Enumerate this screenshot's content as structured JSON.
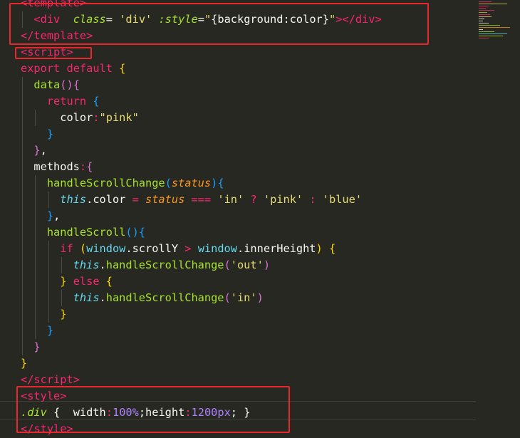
{
  "theme": {
    "background": "#272822",
    "default": "#f8f8f2",
    "tag": "#f92672",
    "attribute": "#a6e22e",
    "string": "#e6db74",
    "keyword": "#f92672",
    "function": "#a6e22e",
    "parameter": "#fd971f",
    "builtin": "#66d9ef",
    "number": "#ae81ff",
    "bracket_gold": "#ffd700",
    "bracket_purple": "#da70d6",
    "bracket_blue": "#179fff",
    "annotation": "#e8282c"
  },
  "code": {
    "lines": [
      [
        [
          "<",
          "tag"
        ],
        [
          "template",
          "tag"
        ],
        [
          ">",
          "tag"
        ]
      ],
      [
        [
          "  ",
          "default"
        ],
        [
          "<",
          "tag"
        ],
        [
          "div",
          "tag"
        ],
        [
          "  ",
          "default"
        ],
        [
          "class",
          "attribute",
          "italic"
        ],
        [
          "= ",
          "default"
        ],
        [
          "'div'",
          "string"
        ],
        [
          " ",
          "default"
        ],
        [
          ":style",
          "attribute",
          "italic"
        ],
        [
          "=",
          "default"
        ],
        [
          "\"",
          "string"
        ],
        [
          "{background:color}",
          "default"
        ],
        [
          "\"",
          "string"
        ],
        [
          "></",
          "tag"
        ],
        [
          "div",
          "tag"
        ],
        [
          ">",
          "tag"
        ]
      ],
      [
        [
          "</",
          "tag"
        ],
        [
          "template",
          "tag"
        ],
        [
          ">",
          "tag"
        ]
      ],
      [
        [
          "<",
          "tag"
        ],
        [
          "script",
          "tag"
        ],
        [
          ">",
          "tag"
        ]
      ],
      [
        [
          "export",
          "keyword"
        ],
        [
          " ",
          "default"
        ],
        [
          "default",
          "keyword"
        ],
        [
          " ",
          "default"
        ],
        [
          "{",
          "bracket_gold"
        ]
      ],
      [
        [
          "  ",
          "default"
        ],
        [
          "data",
          "function"
        ],
        [
          "()",
          "bracket_purple"
        ],
        [
          "{",
          "bracket_purple"
        ]
      ],
      [
        [
          "    ",
          "default"
        ],
        [
          "return",
          "keyword"
        ],
        [
          " ",
          "default"
        ],
        [
          "{",
          "bracket_blue"
        ]
      ],
      [
        [
          "      ",
          "default"
        ],
        [
          "color",
          "default"
        ],
        [
          ":",
          "keyword"
        ],
        [
          "\"pink\"",
          "string"
        ]
      ],
      [
        [
          "    ",
          "default"
        ],
        [
          "}",
          "bracket_blue"
        ]
      ],
      [
        [
          "  ",
          "default"
        ],
        [
          "}",
          "bracket_purple"
        ],
        [
          ",",
          "default"
        ]
      ],
      [
        [
          "  ",
          "default"
        ],
        [
          "methods",
          "default"
        ],
        [
          ":",
          "keyword"
        ],
        [
          "{",
          "bracket_purple"
        ]
      ],
      [
        [
          "    ",
          "default"
        ],
        [
          "handleScrollChange",
          "function"
        ],
        [
          "(",
          "bracket_blue"
        ],
        [
          "status",
          "parameter",
          "italic"
        ],
        [
          ")",
          "bracket_blue"
        ],
        [
          "{",
          "bracket_blue"
        ]
      ],
      [
        [
          "      ",
          "default"
        ],
        [
          "this",
          "builtin",
          "italic"
        ],
        [
          ".color ",
          "default"
        ],
        [
          "=",
          "keyword"
        ],
        [
          " ",
          "default"
        ],
        [
          "status",
          "parameter",
          "italic"
        ],
        [
          " ",
          "default"
        ],
        [
          "===",
          "keyword"
        ],
        [
          " ",
          "default"
        ],
        [
          "'in'",
          "string"
        ],
        [
          " ",
          "default"
        ],
        [
          "?",
          "keyword"
        ],
        [
          " ",
          "default"
        ],
        [
          "'pink'",
          "string"
        ],
        [
          " ",
          "default"
        ],
        [
          ":",
          "keyword"
        ],
        [
          " ",
          "default"
        ],
        [
          "'blue'",
          "string"
        ]
      ],
      [
        [
          "    ",
          "default"
        ],
        [
          "}",
          "bracket_blue"
        ],
        [
          ",",
          "default"
        ]
      ],
      [
        [
          "    ",
          "default"
        ],
        [
          "handleScroll",
          "function"
        ],
        [
          "()",
          "bracket_blue"
        ],
        [
          "{",
          "bracket_blue"
        ]
      ],
      [
        [
          "      ",
          "default"
        ],
        [
          "if",
          "keyword"
        ],
        [
          " ",
          "default"
        ],
        [
          "(",
          "bracket_gold"
        ],
        [
          "window",
          "builtin"
        ],
        [
          ".scrollY ",
          "default"
        ],
        [
          ">",
          "keyword"
        ],
        [
          " ",
          "default"
        ],
        [
          "window",
          "builtin"
        ],
        [
          ".innerHeight",
          "default"
        ],
        [
          ")",
          "bracket_gold"
        ],
        [
          " ",
          "default"
        ],
        [
          "{",
          "bracket_gold"
        ]
      ],
      [
        [
          "        ",
          "default"
        ],
        [
          "this",
          "builtin",
          "italic"
        ],
        [
          ".",
          "default"
        ],
        [
          "handleScrollChange",
          "function"
        ],
        [
          "(",
          "bracket_purple"
        ],
        [
          "'out'",
          "string"
        ],
        [
          ")",
          "bracket_purple"
        ]
      ],
      [
        [
          "      ",
          "default"
        ],
        [
          "}",
          "bracket_gold"
        ],
        [
          " ",
          "default"
        ],
        [
          "else",
          "keyword"
        ],
        [
          " ",
          "default"
        ],
        [
          "{",
          "bracket_gold"
        ]
      ],
      [
        [
          "        ",
          "default"
        ],
        [
          "this",
          "builtin",
          "italic"
        ],
        [
          ".",
          "default"
        ],
        [
          "handleScrollChange",
          "function"
        ],
        [
          "(",
          "bracket_purple"
        ],
        [
          "'in'",
          "string"
        ],
        [
          ")",
          "bracket_purple"
        ]
      ],
      [
        [
          "      ",
          "default"
        ],
        [
          "}",
          "bracket_gold"
        ]
      ],
      [
        [
          "    ",
          "default"
        ],
        [
          "}",
          "bracket_blue"
        ]
      ],
      [
        [
          "  ",
          "default"
        ],
        [
          "}",
          "bracket_purple"
        ]
      ],
      [
        [
          "}",
          "bracket_gold"
        ]
      ],
      [
        [
          "</",
          "tag"
        ],
        [
          "script",
          "tag"
        ],
        [
          ">",
          "tag"
        ]
      ],
      [
        [
          "<",
          "tag"
        ],
        [
          "style",
          "tag"
        ],
        [
          ">",
          "tag"
        ]
      ],
      [
        [
          ".div",
          "attribute",
          "italic"
        ],
        [
          " ",
          "default"
        ],
        [
          "{",
          "default"
        ],
        [
          "  ",
          "default"
        ],
        [
          "width",
          "default"
        ],
        [
          ":",
          "keyword"
        ],
        [
          "100%",
          "number"
        ],
        [
          ";",
          "default"
        ],
        [
          "height",
          "default"
        ],
        [
          ":",
          "keyword"
        ],
        [
          "1200px",
          "number"
        ],
        [
          "; ",
          "default"
        ],
        [
          "}",
          "default"
        ]
      ],
      [
        [
          "</",
          "tag"
        ],
        [
          "style",
          "tag"
        ],
        [
          ">",
          "tag"
        ]
      ]
    ]
  }
}
